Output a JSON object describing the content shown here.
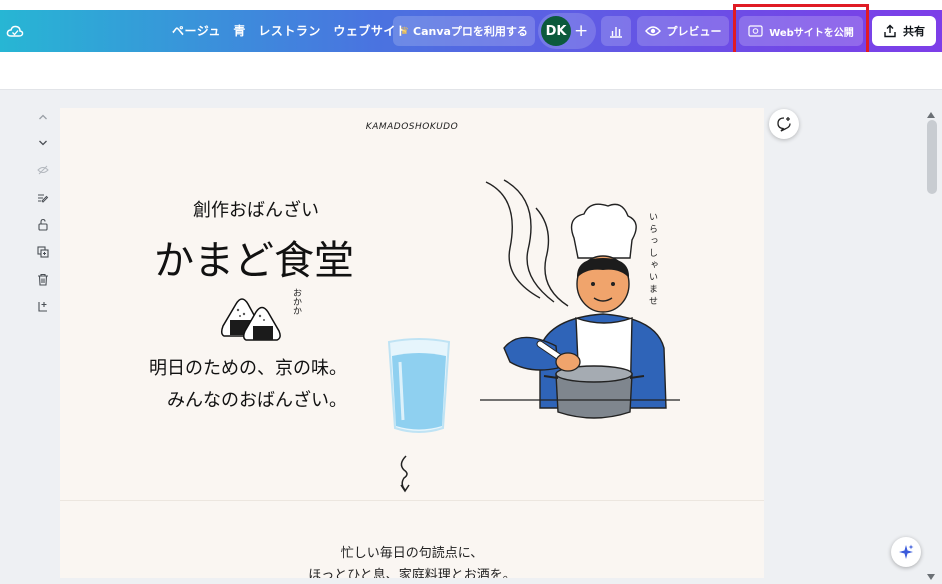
{
  "topbar": {
    "title": "ページュ　青　レストラン　ウェブサイト",
    "pro_button": "Canvaプロを利用する",
    "avatar_initials": "DK",
    "preview_button": "プレビュー",
    "publish_button": "Webサイトを公開",
    "share_button": "共有"
  },
  "page": {
    "brand": "KAMADOSHOKUDO",
    "subtitle": "創作おばんざい",
    "title": "かまど食堂",
    "okaka_label": "おかか",
    "tagline_line1": "明日のための、京の味。",
    "tagline_line2": "みんなのおばんざい。",
    "chef_speech": "いらっしゃいませ",
    "body_line1": "忙しい毎日の句読点に、",
    "body_line2": "ほっとひと息、家庭料理とお酒を。"
  },
  "colors": {
    "topbar_gradient_start": "#27b6d4",
    "topbar_gradient_end": "#7d3ee8",
    "highlight_box": "#e01b24",
    "page_background": "#faf6f2",
    "chef_shirt": "#2f64b8",
    "water": "#8fd0f0"
  },
  "icons": [
    "cloud-icon",
    "crown-icon",
    "plus-icon",
    "stats-icon",
    "eye-icon",
    "publish-icon",
    "share-icon",
    "chevron-up-icon",
    "chevron-down-icon",
    "hide-icon",
    "edit-notes-icon",
    "lock-icon",
    "duplicate-icon",
    "trash-icon",
    "add-page-icon",
    "add-comment-icon",
    "magic-icon"
  ]
}
